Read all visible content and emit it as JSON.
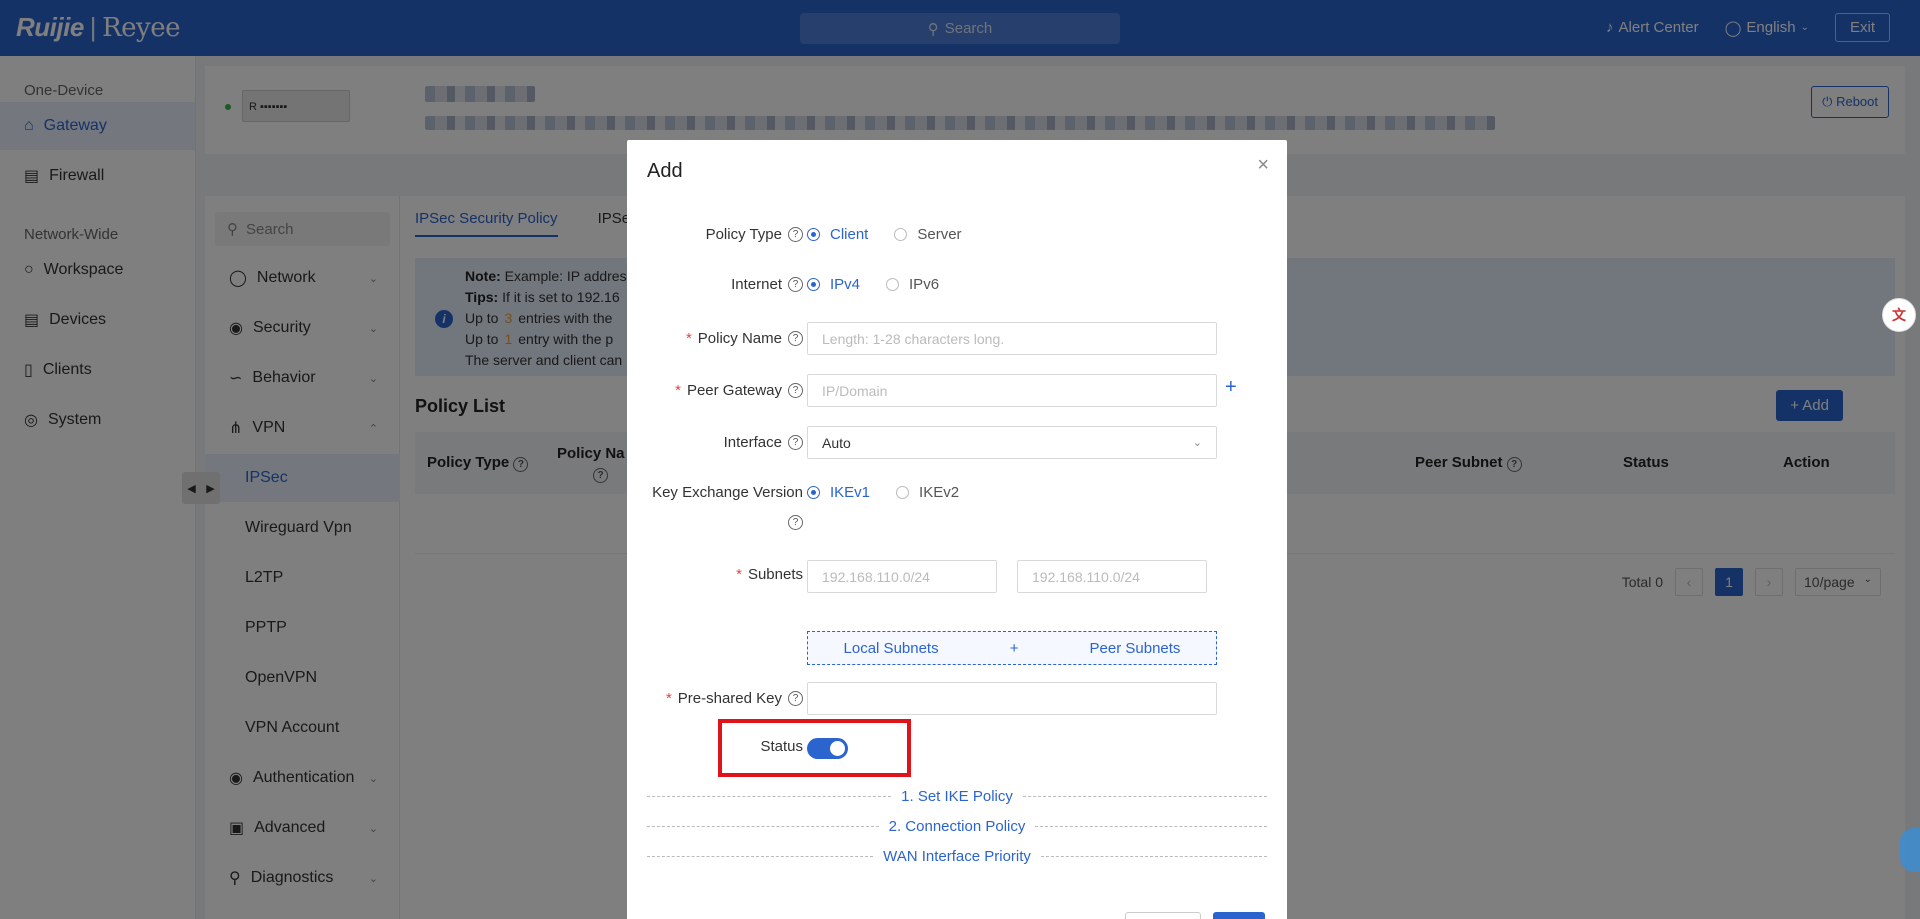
{
  "topbar": {
    "logo_brand": "Ruijie",
    "logo_sub": "Reyee",
    "search_label": "Search",
    "alert_label": "Alert Center",
    "language_label": "English",
    "exit_label": "Exit"
  },
  "left_nav": {
    "group_one_device": "One-Device",
    "gateway": "Gateway",
    "firewall": "Firewall",
    "group_network_wide": "Network-Wide",
    "workspace": "Workspace",
    "devices": "Devices",
    "clients": "Clients",
    "system": "System"
  },
  "device": {
    "model_label": "R",
    "reboot_label": "Reboot"
  },
  "sub_nav": {
    "search_placeholder": "Search",
    "network": "Network",
    "security": "Security",
    "behavior": "Behavior",
    "vpn": "VPN",
    "ipsec": "IPSec",
    "wireguard": "Wireguard Vpn",
    "l2tp": "L2TP",
    "pptp": "PPTP",
    "openvpn": "OpenVPN",
    "vpn_account": "VPN Account",
    "authentication": "Authentication",
    "advanced": "Advanced",
    "diagnostics": "Diagnostics"
  },
  "main": {
    "tab_security_policy": "IPSec Security Policy",
    "tab_second": "IPSec",
    "note_label": "Note:",
    "note_text": "Example: IP addres",
    "tips_label": "Tips:",
    "tips_text": "If it is set to 192.16",
    "upto_a_prefix": "Up to",
    "upto_a_num": "3",
    "upto_a_text": "entries with the",
    "upto_b_prefix": "Up to",
    "upto_b_num": "1",
    "upto_b_text": "entry with the p",
    "server_client_text": "The server and client can",
    "list_title": "Policy List",
    "add_label": "+ Add",
    "th_policy_type": "Policy Type",
    "th_policy_name": "Policy Na",
    "th_peer_subnet": "Peer Subnet",
    "th_status": "Status",
    "th_action": "Action",
    "total_label": "Total 0",
    "current_page": "1",
    "page_size": "10/page"
  },
  "modal": {
    "title": "Add",
    "policy_type_label": "Policy Type",
    "policy_type_client": "Client",
    "policy_type_server": "Server",
    "internet_label": "Internet",
    "internet_ipv4": "IPv4",
    "internet_ipv6": "IPv6",
    "policy_name_label": "Policy Name",
    "policy_name_placeholder": "Length: 1-28 characters long.",
    "peer_gateway_label": "Peer Gateway",
    "peer_gateway_placeholder": "IP/Domain",
    "interface_label": "Interface",
    "interface_value": "Auto",
    "kev_label": "Key Exchange Version",
    "kev_ikev1": "IKEv1",
    "kev_ikev2": "IKEv2",
    "subnets_label": "Subnets",
    "subnet_local_placeholder": "192.168.110.0/24",
    "subnet_peer_placeholder": "192.168.110.0/24",
    "local_subnets": "Local Subnets",
    "peer_subnets": "Peer Subnets",
    "psk_label": "Pre-shared Key",
    "status_label": "Status",
    "status_on": true,
    "section_ike": "1. Set IKE Policy",
    "section_connection": "2. Connection Policy",
    "section_wan": "WAN Interface Priority"
  },
  "colors": {
    "brand": "#2b64cf",
    "highlight": "#e0121a",
    "required": "#e54545"
  }
}
